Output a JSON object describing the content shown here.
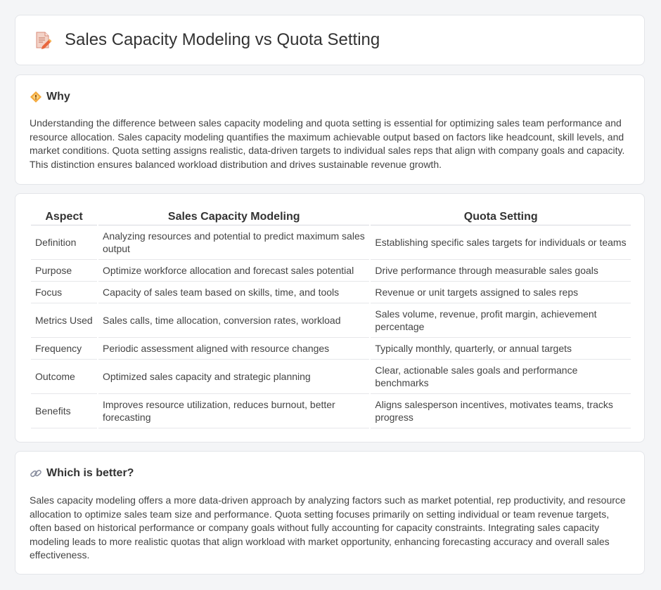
{
  "header": {
    "title": "Sales Capacity Modeling vs Quota Setting",
    "icon": "document-pencil-icon"
  },
  "why": {
    "title": "Why",
    "icon": "diamond-warning-icon",
    "text": "Understanding the difference between sales capacity modeling and quota setting is essential for optimizing sales team performance and resource allocation. Sales capacity modeling quantifies the maximum achievable output based on factors like headcount, skill levels, and market conditions. Quota setting assigns realistic, data-driven targets to individual sales reps that align with company goals and capacity. This distinction ensures balanced workload distribution and drives sustainable revenue growth."
  },
  "table": {
    "headers": [
      "Aspect",
      "Sales Capacity Modeling",
      "Quota Setting"
    ],
    "rows": [
      [
        "Definition",
        "Analyzing resources and potential to predict maximum sales output",
        "Establishing specific sales targets for individuals or teams"
      ],
      [
        "Purpose",
        "Optimize workforce allocation and forecast sales potential",
        "Drive performance through measurable sales goals"
      ],
      [
        "Focus",
        "Capacity of sales team based on skills, time, and tools",
        "Revenue or unit targets assigned to sales reps"
      ],
      [
        "Metrics Used",
        "Sales calls, time allocation, conversion rates, workload",
        "Sales volume, revenue, profit margin, achievement percentage"
      ],
      [
        "Frequency",
        "Periodic assessment aligned with resource changes",
        "Typically monthly, quarterly, or annual targets"
      ],
      [
        "Outcome",
        "Optimized sales capacity and strategic planning",
        "Clear, actionable sales goals and performance benchmarks"
      ],
      [
        "Benefits",
        "Improves resource utilization, reduces burnout, better forecasting",
        "Aligns salesperson incentives, motivates teams, tracks progress"
      ]
    ]
  },
  "better": {
    "title": "Which is better?",
    "icon": "link-icon",
    "text": "Sales capacity modeling offers a more data-driven approach by analyzing factors such as market potential, rep productivity, and resource allocation to optimize sales team size and performance. Quota setting focuses primarily on setting individual or team revenue targets, often based on historical performance or company goals without fully accounting for capacity constraints. Integrating sales capacity modeling leads to more realistic quotas that align workload with market opportunity, enhancing forecasting accuracy and overall sales effectiveness."
  }
}
